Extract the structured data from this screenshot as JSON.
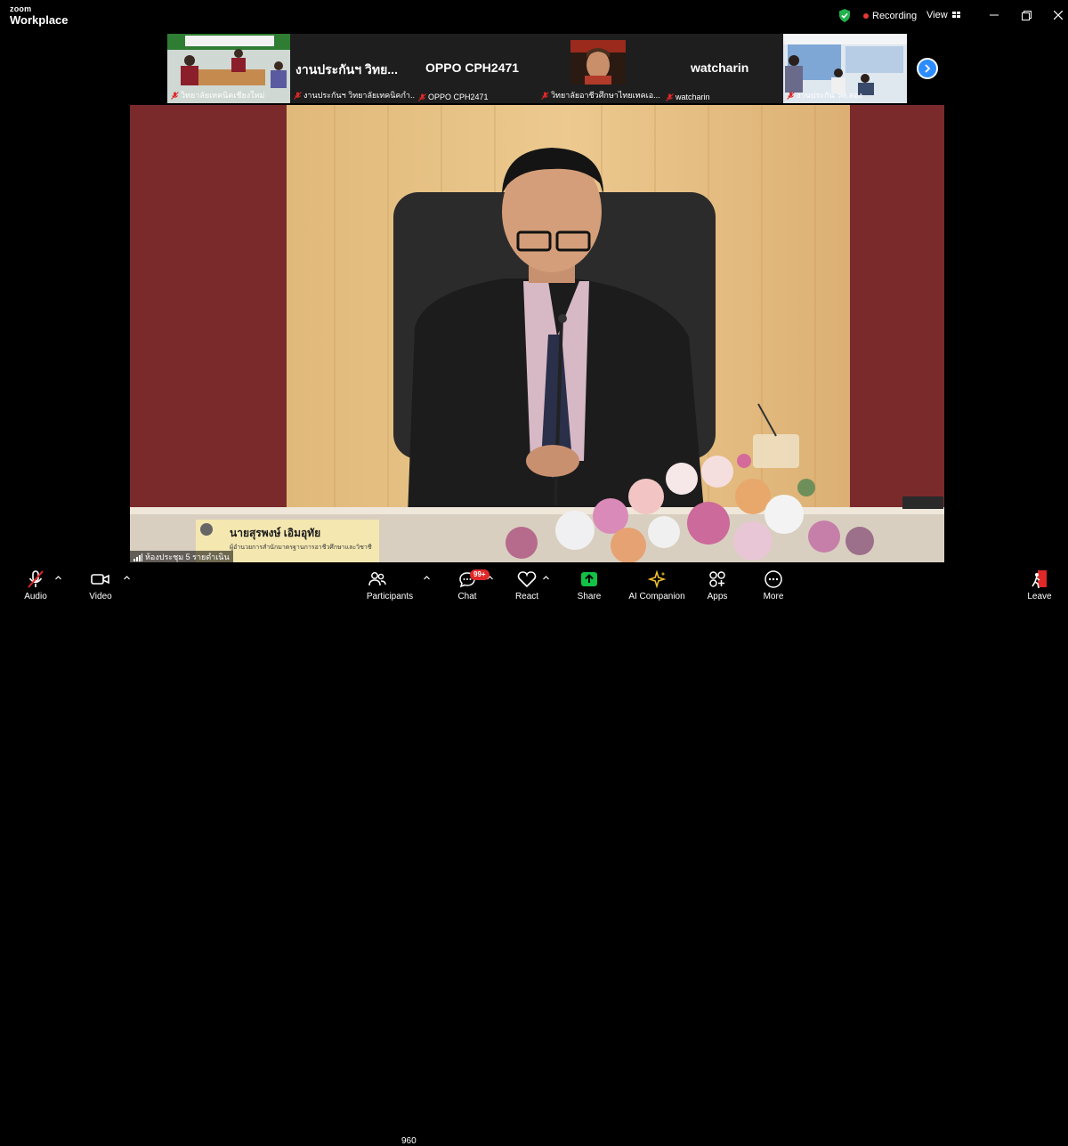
{
  "app": {
    "brand_small": "zoom",
    "brand_large": "Workplace"
  },
  "topbar": {
    "recording": "Recording",
    "view": "View"
  },
  "strip": {
    "tiles": [
      {
        "name": "วิทยาลัยเทคนิคเชียงใหม่"
      },
      {
        "big": "งานประกันฯ วิทย...",
        "name": "งานประกันฯ วิทยาลัยเทคนิคกำ..."
      },
      {
        "big": "OPPO CPH2471",
        "name": "OPPO CPH2471"
      },
      {
        "name": "วิทยาลัยอาชีวศึกษาไทยเทคเอ..."
      },
      {
        "big": "watcharin",
        "name": "watcharin"
      },
      {
        "name": "งานประกัน วท.ลอง"
      }
    ]
  },
  "main": {
    "speaker_room": "ห้องประชุม 5 รายดำเนิน",
    "nameplate_name": "นายสุรพงษ์ เอิมอุทัย",
    "nameplate_title": "ผู้อำนวยการสำนักมาตรฐานการอาชีวศึกษาและวิชาชีพ"
  },
  "toolbar": {
    "audio": "Audio",
    "video": "Video",
    "participants": "Participants",
    "participant_count": "960",
    "chat": "Chat",
    "chat_badge": "99+",
    "react": "React",
    "share": "Share",
    "ai": "AI Companion",
    "apps": "Apps",
    "more": "More",
    "leave": "Leave"
  },
  "colors": {
    "accent": "#2d8cff",
    "share_green": "#12c145",
    "danger": "#e02828",
    "shield": "#22b14c"
  }
}
